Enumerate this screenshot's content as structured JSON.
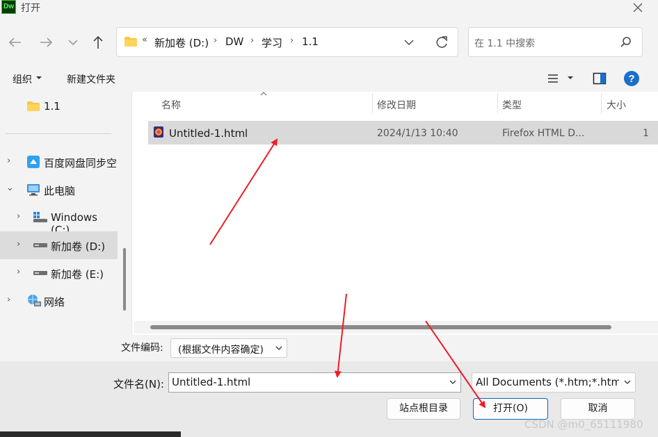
{
  "window": {
    "title": "打开",
    "app_icon_text": "Dw"
  },
  "nav": {
    "breadcrumb_overflow": "«",
    "breadcrumbs": [
      "新加卷 (D:)",
      "DW",
      "学习",
      "1.1"
    ],
    "search_placeholder": "在 1.1 中搜索"
  },
  "toolbar": {
    "organize": "组织",
    "new_folder": "新建文件夹"
  },
  "sidebar": {
    "items": [
      {
        "label": "1.1",
        "icon": "folder-icon"
      },
      {
        "label": "百度网盘同步空",
        "icon": "baidu-netdisk-icon"
      },
      {
        "label": "此电脑",
        "icon": "computer-icon"
      },
      {
        "label": "Windows (C:)",
        "icon": "windows-drive-icon"
      },
      {
        "label": "新加卷 (D:)",
        "icon": "drive-icon",
        "selected": true
      },
      {
        "label": "新加卷 (E:)",
        "icon": "drive-icon"
      },
      {
        "label": "网络",
        "icon": "network-icon"
      }
    ]
  },
  "filelist": {
    "columns": [
      "名称",
      "修改日期",
      "类型",
      "大小"
    ],
    "rows": [
      {
        "name": "Untitled-1.html",
        "modified": "2024/1/13 10:40",
        "type": "Firefox HTML D...",
        "size": "1"
      }
    ]
  },
  "encoding": {
    "label": "文件编码:",
    "value": "(根据文件内容确定)"
  },
  "filename": {
    "label": "文件名(N):",
    "value": "Untitled-1.html"
  },
  "filetype": {
    "value": "All Documents (*.htm;*.html;"
  },
  "buttons": {
    "site_root": "站点根目录",
    "open": "打开(O)",
    "cancel": "取消"
  },
  "watermark": "CSDN @m0_65111980"
}
